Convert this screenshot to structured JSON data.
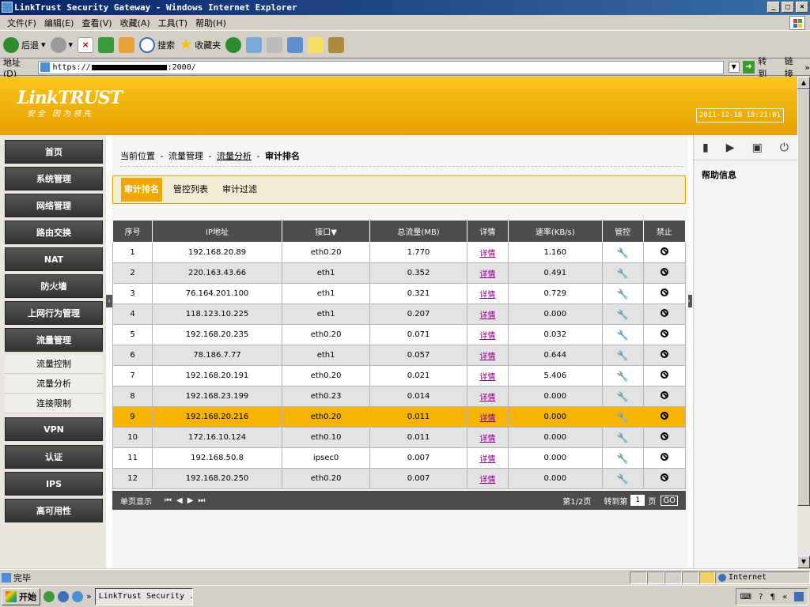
{
  "window": {
    "title": "LinkTrust Security Gateway - Windows Internet Explorer",
    "min": "_",
    "max": "□",
    "close": "×"
  },
  "menu": [
    "文件(F)",
    "编辑(E)",
    "查看(V)",
    "收藏(A)",
    "工具(T)",
    "帮助(H)"
  ],
  "toolbar": {
    "back": "后退",
    "search": "搜索",
    "favorites": "收藏夹"
  },
  "address": {
    "label": "地址(D)",
    "url_prefix": "https://",
    "url_suffix": ":2000/",
    "go": "转到",
    "links": "链接"
  },
  "header": {
    "logo": "LinkTRUST",
    "slogan": "安全 因为领先",
    "datetime": "2011-12-18 18:21:01"
  },
  "nav": {
    "items": [
      "首页",
      "系统管理",
      "网络管理",
      "路由交换",
      "NAT",
      "防火墙",
      "上网行为管理",
      "流量管理",
      "VPN",
      "认证",
      "IPS",
      "高可用性"
    ],
    "sub": [
      "流量控制",
      "流量分析",
      "连接限制"
    ]
  },
  "breadcrumb": {
    "prefix": "当前位置",
    "sep": "-",
    "l1": "流量管理",
    "l2": "流量分析",
    "current": "审计排名"
  },
  "tabs": [
    "审计排名",
    "管控列表",
    "审计过滤"
  ],
  "table": {
    "headers": [
      "序号",
      "IP地址",
      "接口",
      "总流量(MB)",
      "详情",
      "速率(KB/s)",
      "管控",
      "禁止"
    ],
    "rows": [
      [
        "1",
        "192.168.20.89",
        "eth0.20",
        "1.770",
        "详情",
        "1.160"
      ],
      [
        "2",
        "220.163.43.66",
        "eth1",
        "0.352",
        "详情",
        "0.491"
      ],
      [
        "3",
        "76.164.201.100",
        "eth1",
        "0.321",
        "详情",
        "0.729"
      ],
      [
        "4",
        "118.123.10.225",
        "eth1",
        "0.207",
        "详情",
        "0.000"
      ],
      [
        "5",
        "192.168.20.235",
        "eth0.20",
        "0.071",
        "详情",
        "0.032"
      ],
      [
        "6",
        "78.186.7.77",
        "eth1",
        "0.057",
        "详情",
        "0.644"
      ],
      [
        "7",
        "192.168.20.191",
        "eth0.20",
        "0.021",
        "详情",
        "5.406"
      ],
      [
        "8",
        "192.168.23.199",
        "eth0.23",
        "0.014",
        "详情",
        "0.000"
      ],
      [
        "9",
        "192.168.20.216",
        "eth0.20",
        "0.011",
        "详情",
        "0.000"
      ],
      [
        "10",
        "172.16.10.124",
        "eth0.10",
        "0.011",
        "详情",
        "0.000"
      ],
      [
        "11",
        "192.168.50.8",
        "ipsec0",
        "0.007",
        "详情",
        "0.000"
      ],
      [
        "12",
        "192.168.20.250",
        "eth0.20",
        "0.007",
        "详情",
        "0.000"
      ]
    ],
    "selected_row": "9"
  },
  "pager": {
    "mode": "单页显示",
    "first": "⏮",
    "prev": "◀",
    "next": "▶",
    "last": "⏭",
    "page_info": "第1/2页",
    "goto": "转到第",
    "page_input": "1",
    "page_unit": "页",
    "go": "GO"
  },
  "right": {
    "help_title": "帮助信息"
  },
  "status": {
    "text": "完毕",
    "zone": "Internet"
  },
  "taskbar": {
    "start": "开始",
    "item": "LinkTrust Security ..."
  },
  "colors": {
    "accent": "#f0a800",
    "nav_bg": "#404040",
    "row_alt": "#e3e3e3",
    "selected": "#f7b500"
  }
}
